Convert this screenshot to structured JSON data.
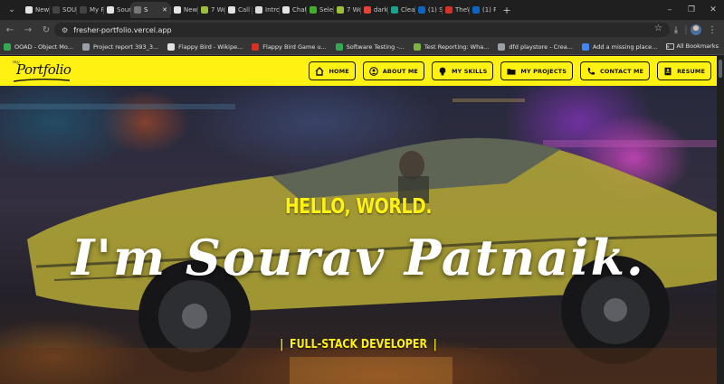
{
  "browser": {
    "tabs": [
      {
        "label": "New",
        "color": "#e3e3e3",
        "active": false
      },
      {
        "label": "SOUI",
        "color": "#444",
        "active": false
      },
      {
        "label": "My P",
        "color": "#444",
        "active": false
      },
      {
        "label": "Sour",
        "color": "#e3e3e3",
        "active": false
      },
      {
        "label": "S",
        "color": "#777",
        "active": true
      },
      {
        "label": "New",
        "color": "#e3e3e3",
        "active": false
      },
      {
        "label": "7 Wo",
        "color": "#9bbf3a",
        "active": false
      },
      {
        "label": "Call C",
        "color": "#e3e3e3",
        "active": false
      },
      {
        "label": "Introd",
        "color": "#ddd",
        "active": false
      },
      {
        "label": "Chatt",
        "color": "#e3e3e3",
        "active": false
      },
      {
        "label": "Selen",
        "color": "#43b02a",
        "active": false
      },
      {
        "label": "7 Wo",
        "color": "#9bbf3a",
        "active": false
      },
      {
        "label": "dark",
        "color": "#ea4335",
        "active": false
      },
      {
        "label": "Clean",
        "color": "#1aa38c",
        "active": false
      },
      {
        "label": "(1) Sr",
        "color": "#0a66c2",
        "active": false
      },
      {
        "label": "TheW",
        "color": "#d93025",
        "active": false
      },
      {
        "label": "(1) P",
        "color": "#0a66c2",
        "active": false
      }
    ],
    "url": "fresher-portfolio.vercel.app",
    "bookmarks": [
      {
        "label": "OOAD - Object Mo...",
        "color": "#34a853"
      },
      {
        "label": "Project report 393_3...",
        "color": "#9aa0a6"
      },
      {
        "label": "Flappy Bird - Wikipe...",
        "color": "#e3e3e3"
      },
      {
        "label": "Flappy Bird Game u...",
        "color": "#d93025"
      },
      {
        "label": "Software Testing -...",
        "color": "#34a853"
      },
      {
        "label": "Test Reporting: Wha...",
        "color": "#7cb342"
      },
      {
        "label": "dfd playstore - Crea...",
        "color": "#9aa0a6"
      },
      {
        "label": "Add a missing place...",
        "color": "#4285f4"
      }
    ],
    "all_bookmarks_label": "All Bookmarks"
  },
  "site": {
    "logo": {
      "prefix": "my",
      "text": "Portfolio"
    },
    "nav": [
      {
        "label": "HOME",
        "icon": "home-icon"
      },
      {
        "label": "ABOUT ME",
        "icon": "user-icon"
      },
      {
        "label": "MY SKILLS",
        "icon": "lightbulb-icon"
      },
      {
        "label": "MY PROJECTS",
        "icon": "folder-icon"
      },
      {
        "label": "CONTACT ME",
        "icon": "phone-icon"
      },
      {
        "label": "RESUME",
        "icon": "document-icon"
      }
    ],
    "hero": {
      "greeting": "HELLO, WORLD.",
      "name": "I'm Sourav Patnaik.",
      "role": "FULL-STACK DEVELOPER",
      "bar": "|"
    },
    "colors": {
      "accent": "#fff212",
      "text_dark": "#111111"
    }
  }
}
